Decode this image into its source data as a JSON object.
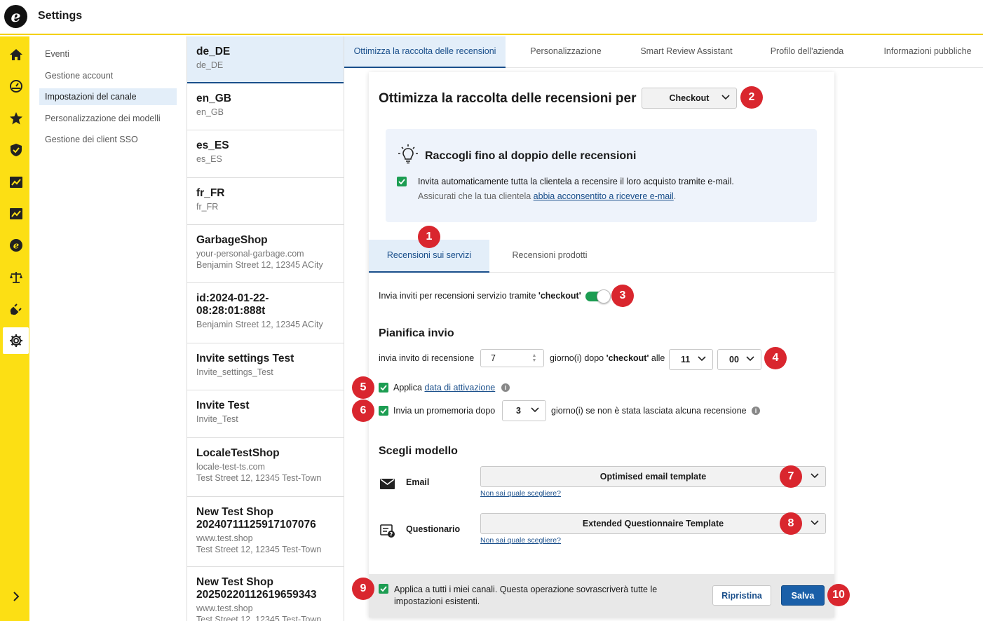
{
  "app": {
    "title": "Settings",
    "logo": "e"
  },
  "rail": {
    "icons": [
      "home-icon",
      "dashboard-icon",
      "star-icon",
      "shield-icon",
      "analytics-icon",
      "reports-icon",
      "trustpilot-icon",
      "legal-icon",
      "integrations-icon",
      "settings-icon"
    ],
    "expand_icon": "chevron-right-icon"
  },
  "subnav": {
    "items": [
      {
        "label": "Eventi"
      },
      {
        "label": "Gestione account"
      },
      {
        "label": "Impostazioni del canale"
      },
      {
        "label": "Personalizzazione dei modelli"
      },
      {
        "label": "Gestione dei client SSO"
      }
    ],
    "active_index": 2
  },
  "shops": [
    {
      "name": "de_DE",
      "sub": [
        "de_DE"
      ]
    },
    {
      "name": "en_GB",
      "sub": [
        "en_GB"
      ]
    },
    {
      "name": "es_ES",
      "sub": [
        "es_ES"
      ]
    },
    {
      "name": "fr_FR",
      "sub": [
        "fr_FR"
      ]
    },
    {
      "name": "GarbageShop",
      "sub": [
        "your-personal-garbage.com",
        "Benjamin Street 12, 12345 ACity"
      ]
    },
    {
      "name": "id:2024-01-22-08:28:01:888t",
      "sub": [
        "Benjamin Street 12, 12345 ACity"
      ]
    },
    {
      "name": "Invite settings Test",
      "sub": [
        "Invite_settings_Test"
      ]
    },
    {
      "name": "Invite Test",
      "sub": [
        "Invite_Test"
      ]
    },
    {
      "name": "LocaleTestShop",
      "sub": [
        "locale-test-ts.com",
        "Test Street 12, 12345 Test-Town"
      ]
    },
    {
      "name": "New Test Shop 20240711125917107076",
      "sub": [
        "www.test.shop",
        "Test Street 12, 12345 Test-Town"
      ]
    },
    {
      "name": "New Test Shop 20250220112619659343",
      "sub": [
        "www.test.shop",
        "Test Street 12, 12345 Test-Town"
      ]
    }
  ],
  "tabs": [
    "Ottimizza la raccolta delle recensioni",
    "Personalizzazione",
    "Smart Review Assistant",
    "Profilo dell'azienda",
    "Informazioni pubbliche"
  ],
  "panel": {
    "heading": "Ottimizza la raccolta delle recensioni per",
    "trigger_select": "Checkout",
    "tip": {
      "title": "Raccogli fino al doppio delle recensioni",
      "line1": "Invita automaticamente tutta la clientela a recensire il loro acquisto tramite e-mail.",
      "line2_prefix": "Assicurati che la tua clientela ",
      "line2_link": "abbia acconsentito a ricevere e-mail",
      "line2_suffix": "."
    },
    "subtabs": [
      "Recensioni sui servizi",
      "Recensioni prodotti"
    ],
    "toggle_label_prefix": "Invia inviti per recensioni servizio tramite ",
    "toggle_label_bold": "'checkout'",
    "toggle_on": true,
    "schedule": {
      "title": "Pianifica invio",
      "label1": "invia invito di recensione",
      "days": "7",
      "label2_prefix": "giorno(i) dopo ",
      "label2_bold": "'checkout'",
      "label2_suffix": " alle",
      "hour": "11",
      "minute": "00"
    },
    "apply_date": {
      "prefix": "Applica ",
      "link": "data di attivazione",
      "checked": true
    },
    "reminder": {
      "label": "Invia un promemoria dopo",
      "days": "3",
      "suffix": "giorno(i) se non è stata lasciata alcuna recensione",
      "checked": true
    },
    "template": {
      "title": "Scegli modello",
      "email_label": "Email",
      "email_value": "Optimised email template",
      "q_label": "Questionario",
      "q_value": "Extended Questionnaire Template",
      "help": "Non sai quale scegliere?"
    },
    "footer": {
      "apply_all": "Applica a tutti i miei canali. Questa operazione sovrascriverà tutte le impostazioni esistenti.",
      "apply_all_line1": "Applica a tutti i miei canali. Questa operazione sovrascriverà tutte le",
      "apply_all_line2": "impostazioni esistenti.",
      "reset": "Ripristina",
      "save": "Salva"
    }
  },
  "badges": [
    "1",
    "2",
    "3",
    "4",
    "5",
    "6",
    "7",
    "8",
    "9",
    "10"
  ],
  "colors": {
    "accent_yellow": "#fcdf14",
    "primary_blue": "#1a5fa8",
    "check_green": "#1c9d52",
    "badge_red": "#d9262e",
    "active_bg": "#e3eef9"
  }
}
